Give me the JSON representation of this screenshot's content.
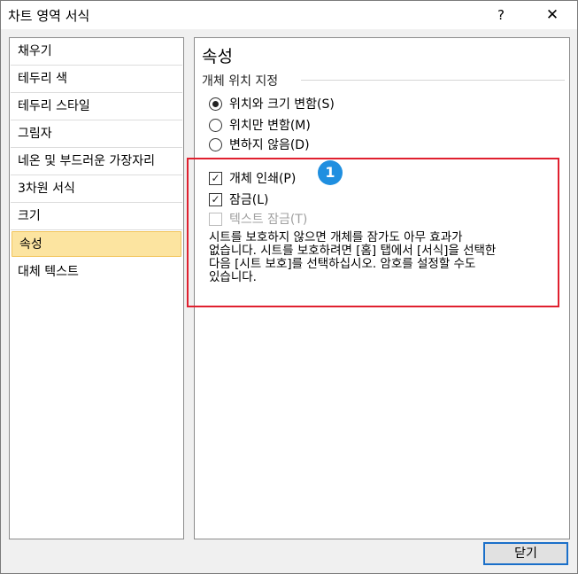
{
  "window": {
    "title": "차트 영역 서식",
    "help_label": "?",
    "close_label": "✕"
  },
  "nav": {
    "items": [
      {
        "label": "채우기"
      },
      {
        "label": "테두리 색"
      },
      {
        "label": "테두리 스타일"
      },
      {
        "label": "그림자"
      },
      {
        "label": "네온 및 부드러운 가장자리"
      },
      {
        "label": "3차원 서식"
      },
      {
        "label": "크기"
      },
      {
        "label": "속성"
      },
      {
        "label": "대체 텍스트"
      }
    ],
    "selected": "속성"
  },
  "properties": {
    "title": "속성",
    "position_group_label": "개체 위치 지정",
    "radios": [
      {
        "label": "위치와 크기 변함(S)",
        "selected": true
      },
      {
        "label": "위치만 변함(M)",
        "selected": false
      },
      {
        "label": "변하지 않음(D)",
        "selected": false
      }
    ],
    "checkboxes": [
      {
        "label": "개체 인쇄(P)",
        "checked": true,
        "enabled": true
      },
      {
        "label": "잠금(L)",
        "checked": true,
        "enabled": true
      },
      {
        "label": "텍스트 잠금(T)",
        "checked": false,
        "enabled": false
      }
    ],
    "description_lines": [
      "시트를 보호하지 않으면 개체를 잠가도 아무 효과가",
      "없습니다. 시트를 보호하려면 [홈] 탭에서 [서식]을 선택한",
      "다음 [시트 보호]를 선택하십시오. 암호를 설정할 수도",
      "있습니다."
    ]
  },
  "annotation": {
    "badge_number": "1",
    "highlight_color": "#e0202f",
    "badge_color": "#1f8fe0"
  },
  "footer": {
    "close_button_label": "닫기"
  }
}
